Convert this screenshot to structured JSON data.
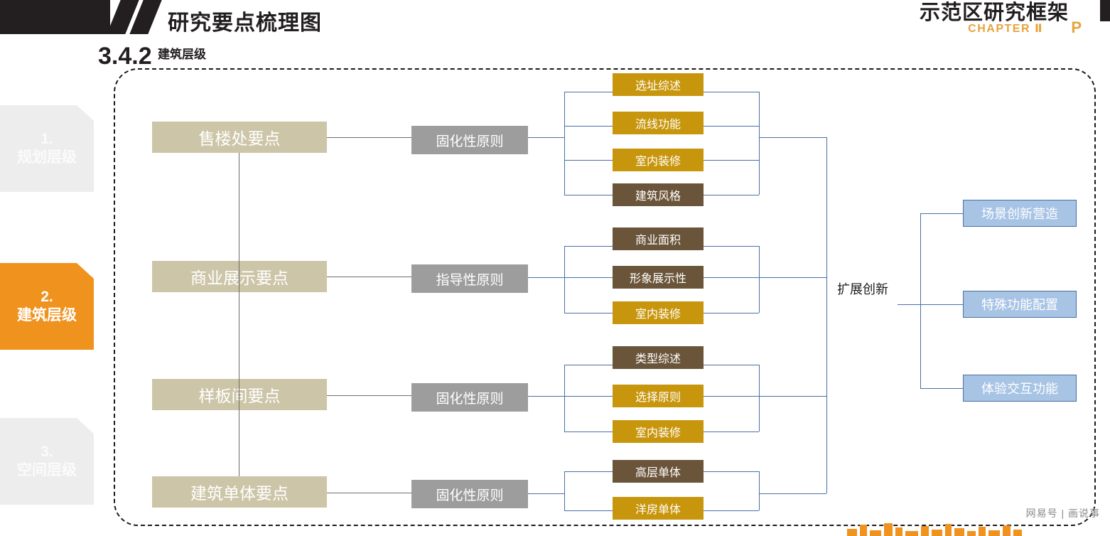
{
  "header": {
    "title": "研究要点梳理图",
    "section_number": "3.4.2",
    "section_label": "建筑层级",
    "right_title": "示范区研究框架",
    "chapter": "CHAPTER",
    "chapter_num": "Ⅱ",
    "right_mark": "P"
  },
  "side_tabs": [
    {
      "num": "1.",
      "label": "规划层级",
      "active": false
    },
    {
      "num": "2.",
      "label": "建筑层级",
      "active": true
    },
    {
      "num": "3.",
      "label": "空间层级",
      "active": false
    }
  ],
  "colors": {
    "accent_orange": "#f0921e",
    "level1": "#cdc5a8",
    "level2": "#9d9d9d",
    "gold": "#c8960c",
    "brown": "#6b553a",
    "blue": "#a8c4e5",
    "line": "#4a6fa5"
  },
  "diagram": {
    "branches": [
      {
        "title": "售楼处要点",
        "principle": "固化性原则",
        "items": [
          {
            "label": "选址综述",
            "style": "gold"
          },
          {
            "label": "流线功能",
            "style": "gold"
          },
          {
            "label": "室内装修",
            "style": "gold"
          },
          {
            "label": "建筑风格",
            "style": "brown"
          }
        ]
      },
      {
        "title": "商业展示要点",
        "principle": "指导性原则",
        "items": [
          {
            "label": "商业面积",
            "style": "brown"
          },
          {
            "label": "形象展示性",
            "style": "brown"
          },
          {
            "label": "室内装修",
            "style": "gold"
          }
        ]
      },
      {
        "title": "样板间要点",
        "principle": "固化性原则",
        "items": [
          {
            "label": "类型综述",
            "style": "brown"
          },
          {
            "label": "选择原则",
            "style": "gold"
          },
          {
            "label": "室内装修",
            "style": "gold"
          }
        ]
      },
      {
        "title": "建筑单体要点",
        "principle": "固化性原则",
        "items": [
          {
            "label": "高层单体",
            "style": "brown"
          },
          {
            "label": "洋房单体",
            "style": "gold"
          }
        ]
      }
    ],
    "hub_label": "扩展创新",
    "outcomes": [
      {
        "label": "场景创新营造"
      },
      {
        "label": "特殊功能配置"
      },
      {
        "label": "体验交互功能"
      }
    ]
  },
  "footer": {
    "watermark": "网易号 | 画说事"
  }
}
